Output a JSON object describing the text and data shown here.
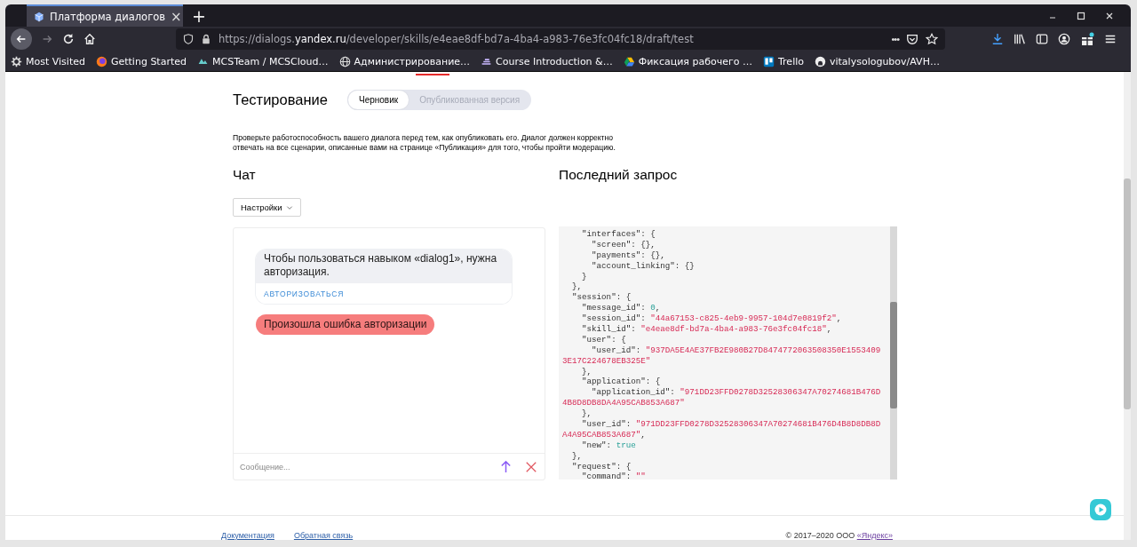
{
  "browser": {
    "tab": {
      "title": "Платформа диалогов",
      "close": "×"
    },
    "new_tab": "+",
    "url": {
      "prefix": "https://dialogs.",
      "host": "yandex.ru",
      "path": "/developer/skills/e4eae8df-bd7a-4ba4-a983-76e3fc04fc18/draft/test"
    },
    "page_actions": "•••",
    "bookmarks": [
      {
        "label": "Most Visited"
      },
      {
        "label": "Getting Started"
      },
      {
        "label": "MCSTeam / MCSCloud…"
      },
      {
        "label": "Администрирование…"
      },
      {
        "label": "Course Introduction &…"
      },
      {
        "label": "Фиксация рабочего …"
      },
      {
        "label": "Trello"
      },
      {
        "label": "vitalysologubov/AVH…"
      }
    ]
  },
  "page": {
    "title": "Тестирование",
    "version_toggle": [
      {
        "label": "Черновик",
        "selected": true
      },
      {
        "label": "Опубликованная версия",
        "selected": false
      }
    ],
    "description": "Проверьте работоспособность вашего диалога перед тем, как опубликовать его. Диалог должен корректно отвечать на все сценарии, описанные вами на странице «Публикация» для того, чтобы пройти модерацию.",
    "chat": {
      "heading": "Чат",
      "settings_button": "Настройки",
      "messages": [
        {
          "kind": "card",
          "text": "Чтобы пользоваться навыком «dialog1», нужна авторизация.",
          "action": "АВТОРИЗОВАТЬСЯ"
        },
        {
          "kind": "error",
          "text": "Произошла ошибка авторизации"
        }
      ],
      "input": {
        "placeholder": "Сообщение..."
      }
    },
    "last_request": {
      "heading": "Последний запрос",
      "code_lines": [
        [
          {
            "kind": "plain",
            "text": "    \"interfaces\": {"
          }
        ],
        [
          {
            "kind": "plain",
            "text": "      \"screen\": {},"
          }
        ],
        [
          {
            "kind": "plain",
            "text": "      \"payments\": {},"
          }
        ],
        [
          {
            "kind": "plain",
            "text": "      \"account_linking\": {}"
          }
        ],
        [
          {
            "kind": "plain",
            "text": "    }"
          }
        ],
        [
          {
            "kind": "plain",
            "text": "  },"
          }
        ],
        [
          {
            "kind": "plain",
            "text": "  \"session\": {"
          }
        ],
        [
          {
            "kind": "plain",
            "text": "    \"message_id\": "
          },
          {
            "kind": "number",
            "text": "0"
          },
          {
            "kind": "plain",
            "text": ","
          }
        ],
        [
          {
            "kind": "plain",
            "text": "    \"session_id\": "
          },
          {
            "kind": "string",
            "text": "\"44a67153-c825-4eb9-9957-104d7e0819f2\""
          },
          {
            "kind": "plain",
            "text": ","
          }
        ],
        [
          {
            "kind": "plain",
            "text": "    \"skill_id\": "
          },
          {
            "kind": "string",
            "text": "\"e4eae8df-bd7a-4ba4-a983-76e3fc04fc18\""
          },
          {
            "kind": "plain",
            "text": ","
          }
        ],
        [
          {
            "kind": "plain",
            "text": "    \"user\": {"
          }
        ],
        [
          {
            "kind": "plain",
            "text": "      \"user_id\": "
          },
          {
            "kind": "string",
            "text": "\"937DA5E4AE37FB2E980B27D8474772063508350E1553409"
          }
        ],
        [
          {
            "kind": "string",
            "text": "3E17C224678EB325E\""
          }
        ],
        [
          {
            "kind": "plain",
            "text": "    },"
          }
        ],
        [
          {
            "kind": "plain",
            "text": "    \"application\": {"
          }
        ],
        [
          {
            "kind": "plain",
            "text": "      \"application_id\": "
          },
          {
            "kind": "string",
            "text": "\"971DD23FFD0278D32528306347A70274681B476D"
          }
        ],
        [
          {
            "kind": "string",
            "text": "4B8D8DB8DA4A95CAB853A687\""
          }
        ],
        [
          {
            "kind": "plain",
            "text": "    },"
          }
        ],
        [
          {
            "kind": "plain",
            "text": "    \"user_id\": "
          },
          {
            "kind": "string",
            "text": "\"971DD23FFD0278D32528306347A70274681B476D4B8D8DB8D"
          }
        ],
        [
          {
            "kind": "string",
            "text": "A4A95CAB853A687\""
          },
          {
            "kind": "plain",
            "text": ","
          }
        ],
        [
          {
            "kind": "plain",
            "text": "    \"new\": "
          },
          {
            "kind": "number",
            "text": "true"
          }
        ],
        [
          {
            "kind": "plain",
            "text": "  },"
          }
        ],
        [
          {
            "kind": "plain",
            "text": "  \"request\": {"
          }
        ],
        [
          {
            "kind": "plain",
            "text": "    \"command\": "
          },
          {
            "kind": "string",
            "text": "\"\""
          }
        ]
      ]
    }
  },
  "footer": {
    "links": [
      "Документация",
      "Обратная связь"
    ],
    "copyright_prefix": "© 2017–2020 ООО ",
    "copyright_link": "«Яндекс»"
  }
}
